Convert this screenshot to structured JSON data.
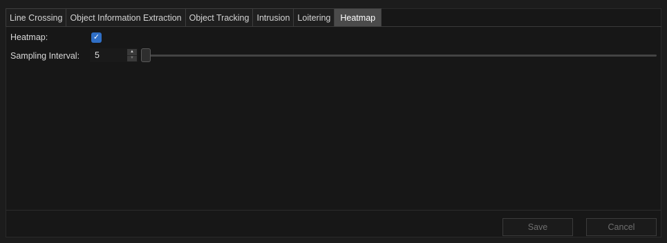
{
  "tabs": [
    {
      "label": "Line Crossing",
      "active": false
    },
    {
      "label": "Object Information Extraction",
      "active": false
    },
    {
      "label": "Object Tracking",
      "active": false
    },
    {
      "label": "Intrusion",
      "active": false
    },
    {
      "label": "Loitering",
      "active": false
    },
    {
      "label": "Heatmap",
      "active": true
    }
  ],
  "heatmap": {
    "label": "Heatmap:",
    "checked": true,
    "check_glyph": "✓"
  },
  "sampling": {
    "label": "Sampling Interval:",
    "value": "5",
    "up_glyph": "▲",
    "down_glyph": "▼",
    "slider_fraction": 0.0
  },
  "footer": {
    "save_label": "Save",
    "cancel_label": "Cancel",
    "save_enabled": false,
    "cancel_enabled": false
  },
  "colors": {
    "background": "#171717",
    "checkbox": "#2f6fc6",
    "active_tab": "#4b4b4b"
  }
}
